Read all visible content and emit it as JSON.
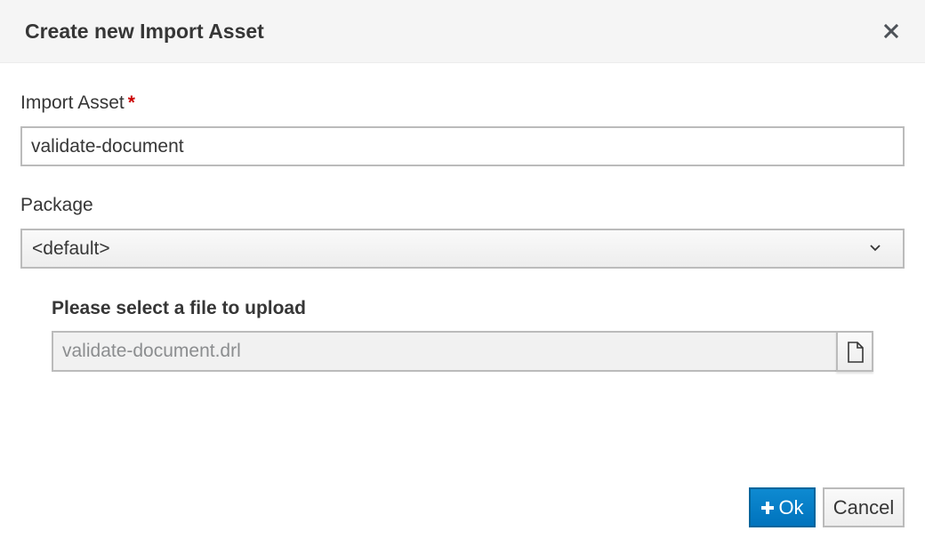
{
  "dialog": {
    "title": "Create new Import Asset",
    "close_icon": "close-icon"
  },
  "form": {
    "import_asset": {
      "label": "Import Asset",
      "required_mark": "*",
      "value": "validate-document"
    },
    "package": {
      "label": "Package",
      "selected": "<default>",
      "icon": "chevron-down-icon"
    },
    "upload": {
      "label": "Please select a file to upload",
      "value": "validate-document.drl",
      "browse_icon": "file-icon"
    }
  },
  "footer": {
    "ok_label": "Ok",
    "ok_icon": "plus-icon",
    "cancel_label": "Cancel"
  },
  "colors": {
    "primary": "#0073bd",
    "required": "#cc0000",
    "header_bg": "#f5f5f5",
    "text": "#363636"
  }
}
